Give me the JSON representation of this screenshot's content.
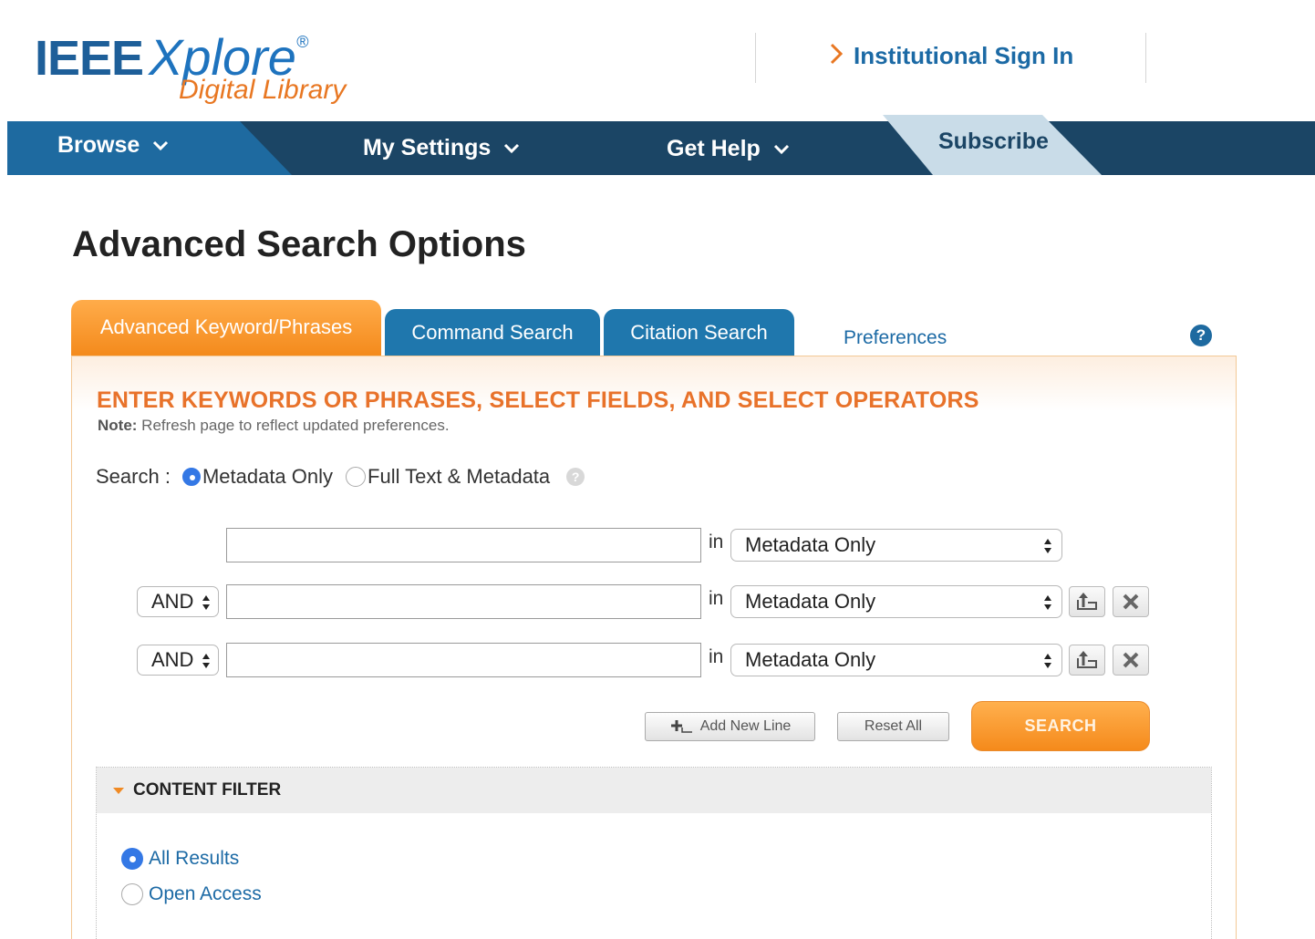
{
  "header": {
    "logo_main": "IEEE",
    "logo_product": "Xplore",
    "logo_reg": "®",
    "logo_sub": "Digital Library",
    "signin_label": "Institutional Sign In"
  },
  "nav": {
    "browse": "Browse",
    "my_settings": "My Settings",
    "get_help": "Get Help",
    "subscribe": "Subscribe"
  },
  "page_title": "Advanced Search Options",
  "tabs": {
    "advanced": "Advanced Keyword/Phrases",
    "command": "Command Search",
    "citation": "Citation Search",
    "preferences": "Preferences",
    "help_glyph": "?"
  },
  "form": {
    "heading": "ENTER KEYWORDS OR PHRASES, SELECT FIELDS, AND SELECT OPERATORS",
    "note_label": "Note:",
    "note_text": " Refresh page to reflect updated preferences.",
    "search_label": "Search :",
    "scope_metadata": "Metadata Only",
    "scope_fulltext": "Full Text & Metadata",
    "in_label": "in",
    "rows": [
      {
        "operator": "",
        "value": "",
        "field": "Metadata Only"
      },
      {
        "operator": "AND",
        "value": "",
        "field": "Metadata Only"
      },
      {
        "operator": "AND",
        "value": "",
        "field": "Metadata Only"
      }
    ],
    "add_line": "Add New Line",
    "reset_all": "Reset All",
    "search_button": "SEARCH"
  },
  "content_filter": {
    "title": "CONTENT FILTER",
    "options": [
      "All Results",
      "Open Access"
    ],
    "selected": "All Results"
  },
  "colors": {
    "brand_blue": "#1e6aa0",
    "nav_dark": "#1b4565",
    "accent_orange": "#f48a1c",
    "link_blue": "#1c6aa5"
  }
}
